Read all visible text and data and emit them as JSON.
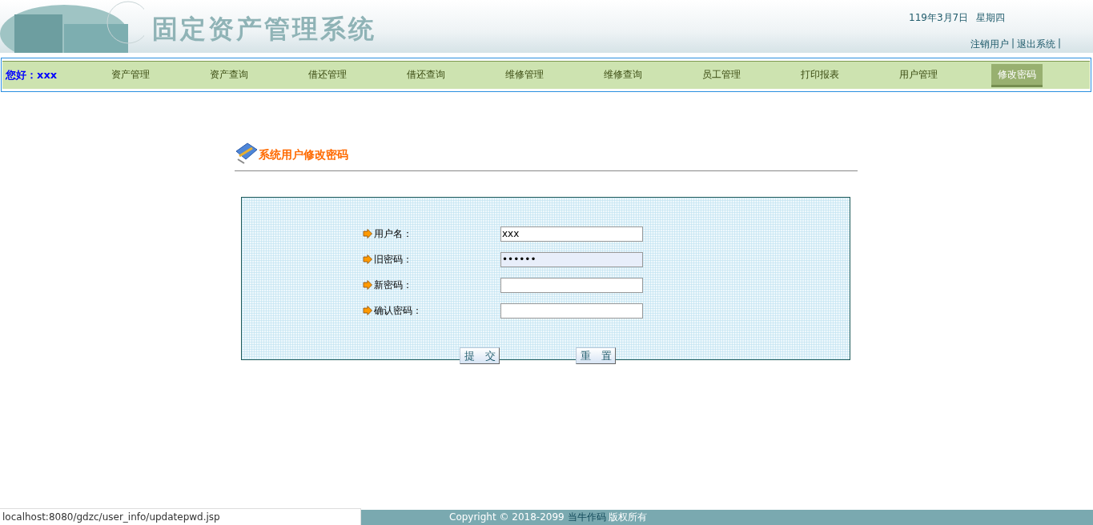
{
  "header": {
    "title": "固定资产管理系统",
    "date": "119年3月7日",
    "weekday": "星期四",
    "links": [
      {
        "label": "注销用户",
        "separator": "|"
      },
      {
        "label": "退出系统",
        "separator": "|"
      }
    ]
  },
  "nav": {
    "greeting": "您好：xxx",
    "items": [
      {
        "label": "资产管理",
        "selected": false
      },
      {
        "label": "资产查询",
        "selected": false
      },
      {
        "label": "借还管理",
        "selected": false
      },
      {
        "label": "借还查询",
        "selected": false
      },
      {
        "label": "维修管理",
        "selected": false
      },
      {
        "label": "维修查询",
        "selected": false
      },
      {
        "label": "员工管理",
        "selected": false
      },
      {
        "label": "打印报表",
        "selected": false
      },
      {
        "label": "用户管理",
        "selected": false
      },
      {
        "label": "修改密码",
        "selected": true
      }
    ]
  },
  "form": {
    "heading": "系统用户修改密码",
    "fields": [
      {
        "label": "用户名：",
        "value": "xxx",
        "focused": false
      },
      {
        "label": "旧密码：",
        "value": "••••••",
        "focused": true
      },
      {
        "label": "新密码：",
        "focused": false
      },
      {
        "label": "确认密码：",
        "focused": false
      }
    ],
    "buttons": [
      "提　交",
      "重　置"
    ]
  },
  "status_url": "localhost:8080/gdzc/user_info/updatepwd.jsp",
  "footer": {
    "copyright": "Copyright © 2018-2099",
    "author": "当牛作码",
    "rights": "版权所有"
  }
}
